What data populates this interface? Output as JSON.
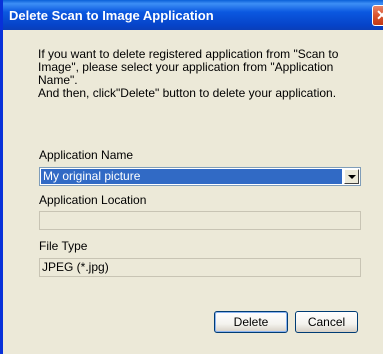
{
  "window": {
    "title": "Delete Scan to Image Application",
    "close_glyph": "✕"
  },
  "instructions": {
    "line1": "If you want to delete registered application from \"Scan to Image\", please select your application from \"Application Name\".",
    "line2": "And then, click\"Delete\" button to delete your application."
  },
  "app_name": {
    "label": "Application Name",
    "selected": "My original picture"
  },
  "app_location": {
    "label": "Application Location",
    "value": ""
  },
  "file_type": {
    "label": "File Type",
    "value": "JPEG (*.jpg)"
  },
  "buttons": {
    "delete": "Delete",
    "cancel": "Cancel"
  },
  "colors": {
    "title_bar": "#0b58e0",
    "selection": "#316ac5",
    "dialog_bg": "#ece9d8"
  },
  "icons": {
    "close": "close-icon",
    "dropdown": "chevron-down-icon"
  }
}
